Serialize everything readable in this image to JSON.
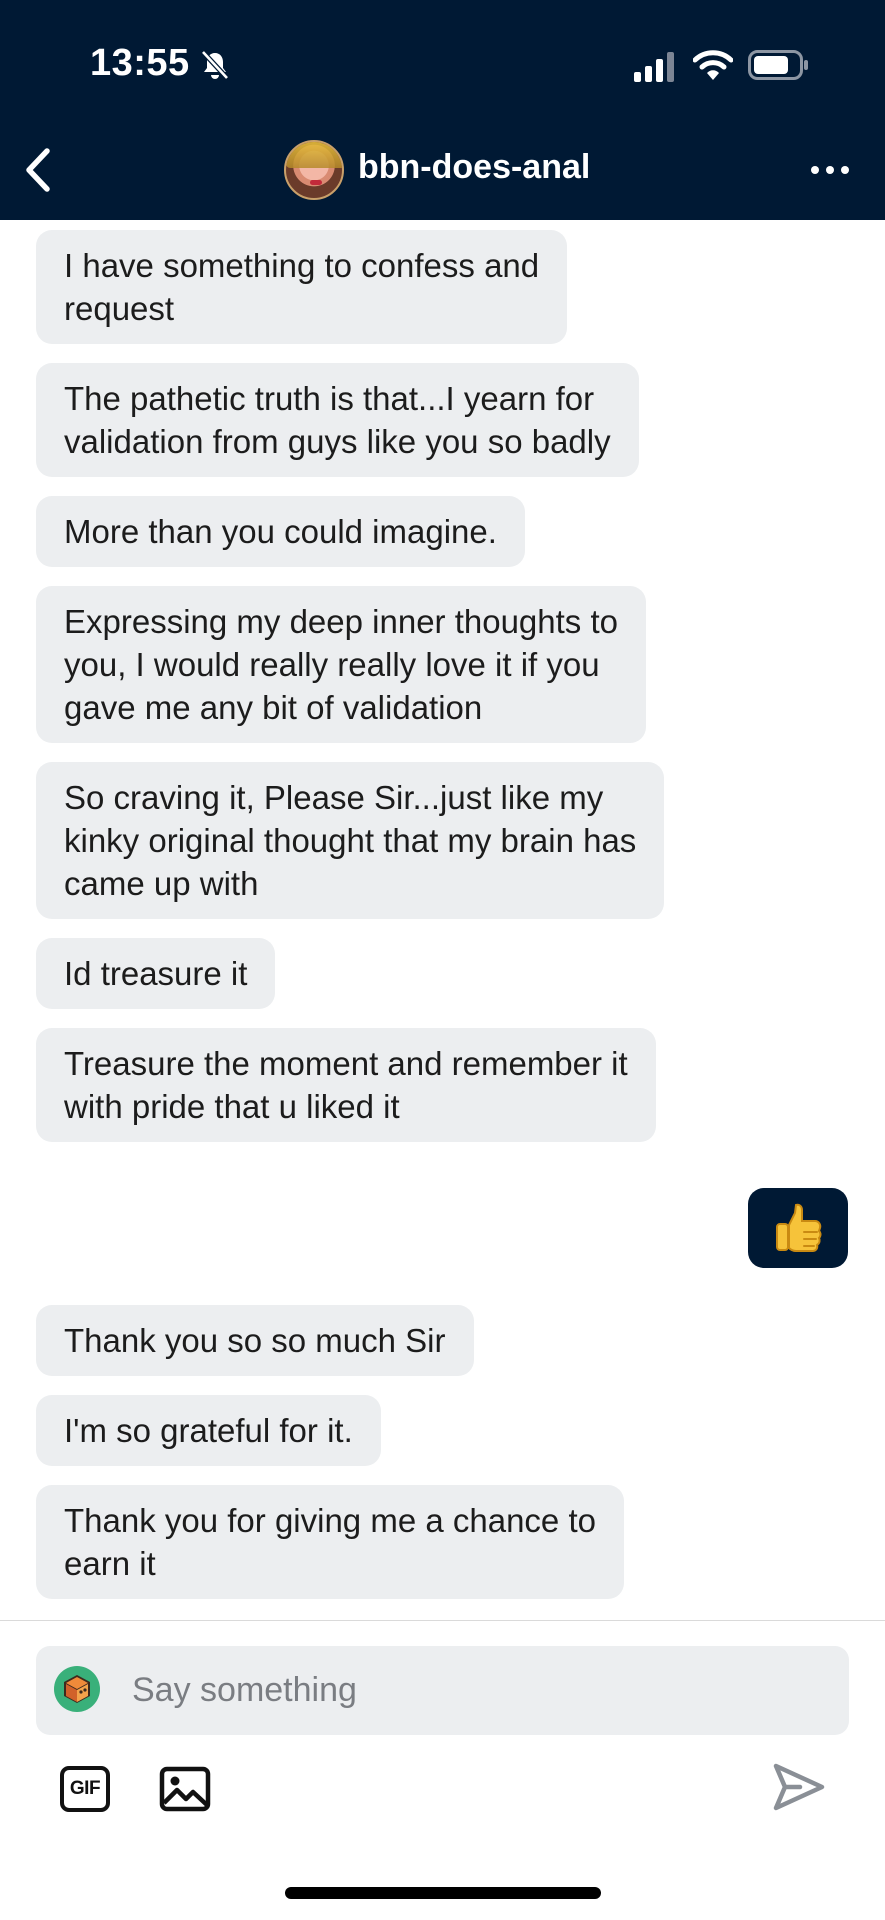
{
  "status_bar": {
    "time": "13:55"
  },
  "header": {
    "title": "bbn-does-anal"
  },
  "messages": [
    {
      "lines": [
        "I have something to confess and",
        "request"
      ]
    },
    {
      "lines": [
        "The pathetic truth is that...I yearn for",
        "validation from guys like you so badly"
      ]
    },
    {
      "lines": [
        "More than you could imagine."
      ]
    },
    {
      "lines": [
        "Expressing my deep inner thoughts to",
        "you, I would really really love it if you",
        "gave me any bit of validation"
      ]
    },
    {
      "lines": [
        "So craving it, Please Sir...just like my",
        "kinky original thought that my brain has",
        "came up with"
      ]
    },
    {
      "lines": [
        "Id treasure it"
      ]
    },
    {
      "lines": [
        "Treasure the moment and remember it",
        "with pride that u liked it"
      ]
    },
    {
      "lines": [
        "Thank you so so much Sir"
      ]
    },
    {
      "lines": [
        "I'm so grateful for it."
      ]
    },
    {
      "lines": [
        "Thank you for giving me a chance to",
        "earn it"
      ]
    }
  ],
  "sent_message": {
    "emoji": "thumbs-up-emoji"
  },
  "composer": {
    "placeholder": "Say something"
  },
  "toolbar": {
    "gif_label": "GIF"
  },
  "colors": {
    "header_bg": "#001934",
    "bubble_bg": "#eceef0",
    "sent_bg": "#001934",
    "text": "#1c1c1c"
  }
}
